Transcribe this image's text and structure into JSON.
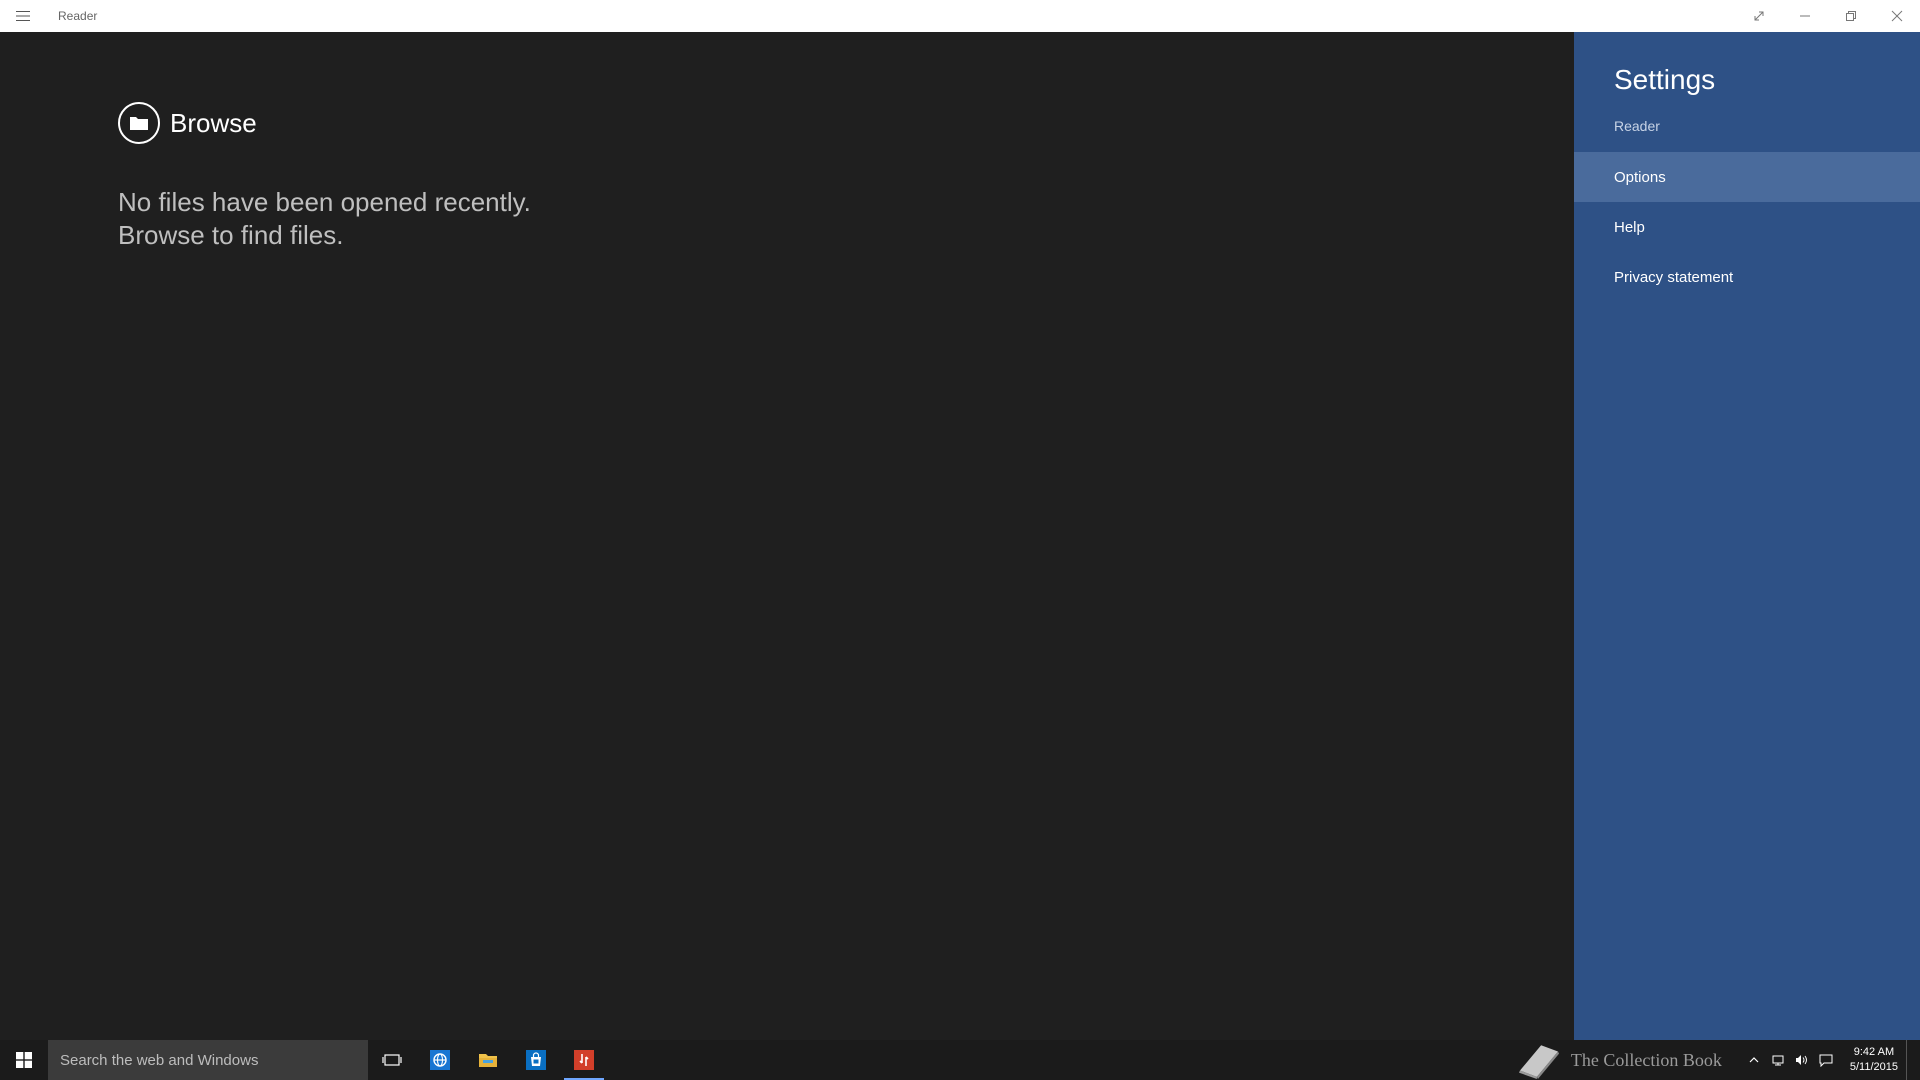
{
  "app": {
    "title": "Reader"
  },
  "titlebar": {
    "controls": [
      {
        "name": "full-screen",
        "icon": "expand-icon"
      },
      {
        "name": "minimize",
        "icon": "minimize-icon"
      },
      {
        "name": "restore",
        "icon": "restore-icon"
      },
      {
        "name": "close",
        "icon": "close-icon"
      }
    ]
  },
  "main": {
    "browse_label": "Browse",
    "empty_line1": "No files have been opened recently.",
    "empty_line2": "Browse to find files."
  },
  "settings": {
    "title": "Settings",
    "subtitle": "Reader",
    "items": [
      {
        "label": "Options",
        "selected": true
      },
      {
        "label": "Help",
        "selected": false
      },
      {
        "label": "Privacy statement",
        "selected": false
      }
    ]
  },
  "taskbar": {
    "search_placeholder": "Search the web and Windows",
    "pinned": [
      "task-view-icon",
      "internet-explorer-icon",
      "file-explorer-icon",
      "store-icon",
      "reader-app-icon"
    ],
    "watermark_text": "The Collection Book",
    "clock_time": "9:42 AM",
    "clock_date": "5/11/2015"
  },
  "colors": {
    "titlebar_bg": "#ffffff",
    "content_bg": "#1f1f1f",
    "settings_bg": "#2e5186",
    "settings_selected": "#4a6b9c",
    "taskbar_bg": "#1b1b1b",
    "search_bg": "#3b3b3b",
    "reader_red": "#d23f2a",
    "ie_blue": "#1976d2",
    "store_blue": "#0a6fc2",
    "folder_yellow": "#f0c24a"
  }
}
